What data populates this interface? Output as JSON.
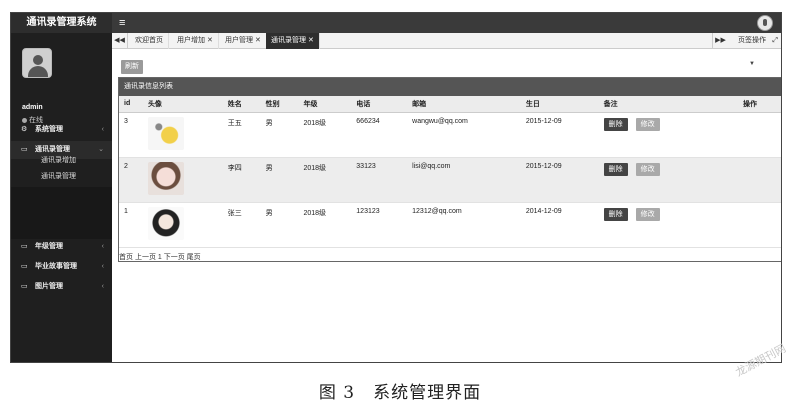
{
  "app": {
    "title": "通讯录管理系统",
    "menu_icon": "≡"
  },
  "user": {
    "name": "admin",
    "status": "在线"
  },
  "sidebar": {
    "items": [
      {
        "label": "系统管理",
        "icon": "gear-icon"
      },
      {
        "label": "通讯录管理",
        "icon": "monitor-icon",
        "sub": [
          "通讯录增加",
          "通讯录管理"
        ]
      },
      {
        "label": "年级管理",
        "icon": "monitor-icon"
      },
      {
        "label": "毕业故事管理",
        "icon": "monitor-icon"
      },
      {
        "label": "图片管理",
        "icon": "monitor-icon"
      }
    ]
  },
  "tabs": [
    {
      "label": "欢迎首页",
      "closable": false
    },
    {
      "label": "用户增加",
      "closable": true
    },
    {
      "label": "用户管理",
      "closable": true
    },
    {
      "label": "通讯录管理",
      "closable": true,
      "active": true
    }
  ],
  "tab_controls": {
    "prev": "◀◀",
    "next": "▶▶",
    "page_ops": "页签操作",
    "fullscreen": "⤢"
  },
  "toolbar": {
    "refresh": "刷新"
  },
  "panel": {
    "title": "通讯录信息列表"
  },
  "table": {
    "headers": [
      "id",
      "头像",
      "姓名",
      "性别",
      "年级",
      "电话",
      "邮箱",
      "生日",
      "备注",
      "操作"
    ],
    "rows": [
      {
        "id": "3",
        "name": "王五",
        "gender": "男",
        "grade": "2018级",
        "phone": "666234",
        "email": "wangwu@qq.com",
        "birthday": "2015-12-09"
      },
      {
        "id": "2",
        "name": "李四",
        "gender": "男",
        "grade": "2018级",
        "phone": "33123",
        "email": "lisi@qq.com",
        "birthday": "2015-12-09"
      },
      {
        "id": "1",
        "name": "张三",
        "gender": "男",
        "grade": "2018级",
        "phone": "123123",
        "email": "12312@qq.com",
        "birthday": "2014-12-09"
      }
    ],
    "delete_label": "删除",
    "edit_label": "修改"
  },
  "pagination": {
    "text": "首页 上一页 1 下一页 尾页"
  },
  "caption": "图 3　系统管理界面",
  "watermark": "龙源期刊网"
}
